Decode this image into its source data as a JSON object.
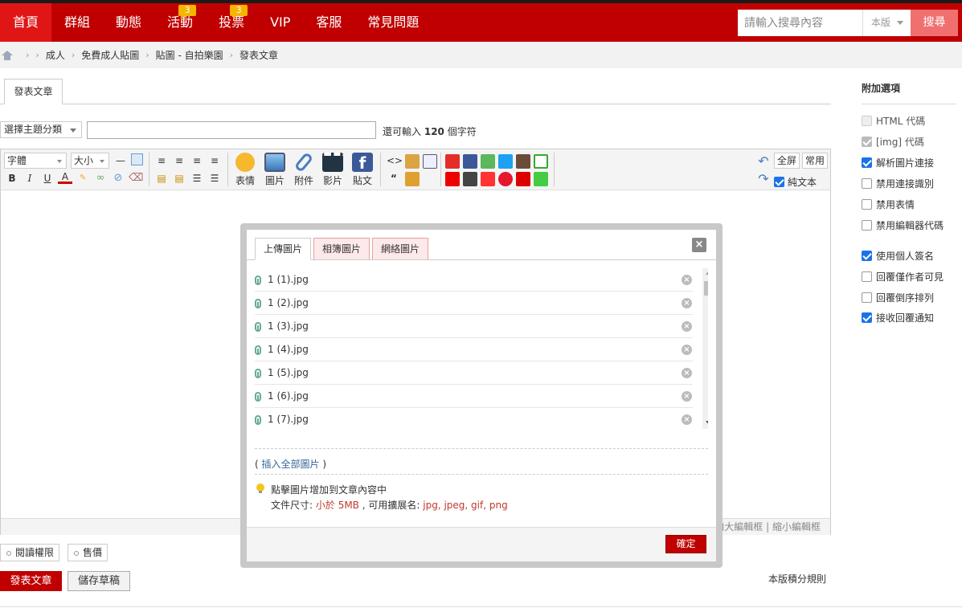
{
  "nav": {
    "items": [
      {
        "label": "首頁",
        "badge": ""
      },
      {
        "label": "群組",
        "badge": ""
      },
      {
        "label": "動態",
        "badge": ""
      },
      {
        "label": "活動",
        "badge": "3"
      },
      {
        "label": "投票",
        "badge": "3"
      },
      {
        "label": "VIP",
        "badge": ""
      },
      {
        "label": "客服",
        "badge": ""
      },
      {
        "label": "常見問題",
        "badge": ""
      }
    ],
    "search_placeholder": "請輸入搜尋內容",
    "search_scope": "本版",
    "search_button": "搜尋"
  },
  "breadcrumb": [
    "成人",
    "免費成人貼圖",
    "貼圖 - 自拍樂園",
    "發表文章"
  ],
  "post_tab": "發表文章",
  "subject": {
    "type_select": "選擇主題分類",
    "hint_prefix": "還可輸入",
    "hint_count": "120",
    "hint_suffix": "個字符"
  },
  "toolbar": {
    "font": "字體",
    "size": "大小",
    "big_buttons": [
      "表情",
      "圖片",
      "附件",
      "影片",
      "貼文"
    ],
    "fullscreen": "全屏",
    "common": "常用",
    "plain_text": "純文本"
  },
  "editor_bottom": {
    "enlarge": "加大編輯框",
    "separator": "|",
    "shrink": "縮小編輯框"
  },
  "side": {
    "title": "附加選項",
    "options": [
      {
        "label": "HTML 代碼",
        "checked": false,
        "disabled": true
      },
      {
        "label": "[img] 代碼",
        "checked": true,
        "disabled": true
      },
      {
        "label": "解析圖片連接",
        "checked": true,
        "disabled": false
      },
      {
        "label": "禁用連接識別",
        "checked": false,
        "disabled": false
      },
      {
        "label": "禁用表情",
        "checked": false,
        "disabled": false
      },
      {
        "label": "禁用編輯器代碼",
        "checked": false,
        "disabled": false
      },
      {
        "label": "使用個人簽名",
        "checked": true,
        "disabled": false
      },
      {
        "label": "回覆僅作者可見",
        "checked": false,
        "disabled": false
      },
      {
        "label": "回覆倒序排列",
        "checked": false,
        "disabled": false
      },
      {
        "label": "接收回覆通知",
        "checked": true,
        "disabled": false
      }
    ]
  },
  "actions": {
    "read_perm": "閱讀權限",
    "price": "售價",
    "post": "發表文章",
    "save_draft": "儲存草稿",
    "rules": "本版積分規則"
  },
  "dialog": {
    "tabs": [
      "上傳圖片",
      "相簿圖片",
      "網絡圖片"
    ],
    "close": "×",
    "files": [
      "1 (1).jpg",
      "1 (2).jpg",
      "1 (3).jpg",
      "1 (4).jpg",
      "1 (5).jpg",
      "1 (6).jpg",
      "1 (7).jpg"
    ],
    "insert_open": "(",
    "insert_all": "插入全部圖片",
    "insert_close": ")",
    "tip1": "點擊圖片增加到文章內容中",
    "tip2_prefix": "文件尺寸:",
    "tip2_size": "小於 5MB",
    "tip2_mid": ", 可用擴展名:",
    "tip2_ext": "jpg, jpeg, gif, png",
    "ok": "確定"
  },
  "colors": {
    "brand_red": "#c00000",
    "nav_active": "#e01616",
    "badge": "#f4b400",
    "checkbox_blue": "#1a73e8"
  }
}
